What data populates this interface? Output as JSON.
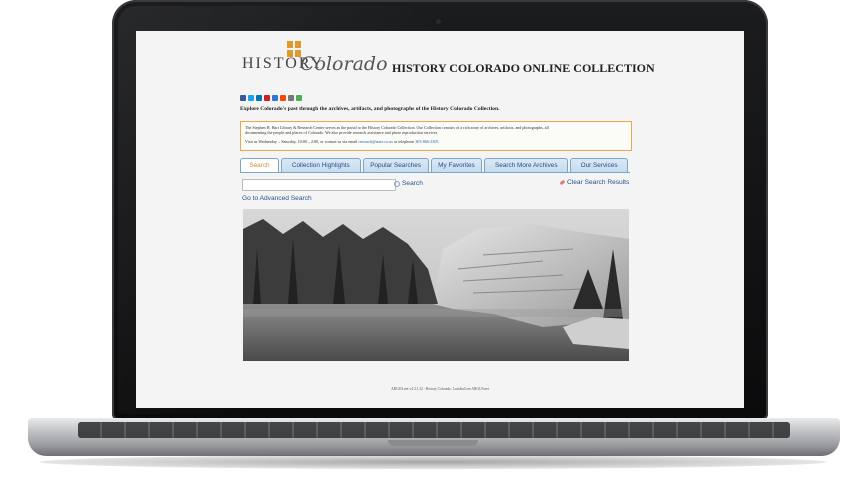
{
  "site": {
    "logo_word": "HISTORY",
    "logo_script": "Colorado",
    "title": "HISTORY COLORADO ONLINE COLLECTION",
    "tagline": "Explore Colorado's past through the archives, artifacts, and photographs of the History Colorado Collection."
  },
  "social_icons": [
    {
      "name": "facebook-icon",
      "color": "#3b5998"
    },
    {
      "name": "twitter-icon",
      "color": "#1da1f2"
    },
    {
      "name": "linkedin-icon",
      "color": "#0077b5"
    },
    {
      "name": "pinterest-icon",
      "color": "#cb2027"
    },
    {
      "name": "delicious-icon",
      "color": "#3274d1"
    },
    {
      "name": "reddit-icon",
      "color": "#ff4500"
    },
    {
      "name": "email-icon",
      "color": "#777777"
    },
    {
      "name": "share-icon",
      "color": "#4caf50"
    }
  ],
  "info": {
    "line1": "The Stephen H. Hart Library & Research Center serves as the portal to the History Colorado Collection. Our Collection consists of a rich array of archives, artifacts, and photographs, all",
    "line2": "documenting the people and places of Colorado. We also provide research assistance and photo reproduction services.",
    "line3_prefix": "Visit us Wednesday – Saturday, 10:00 – 2:00, or contact us via email",
    "email": "research@state.co.us",
    "line3_mid": "or telephone",
    "phone": "303-866-2305."
  },
  "tabs": [
    {
      "label": "Search",
      "active": true
    },
    {
      "label": "Collection Highlights",
      "active": false
    },
    {
      "label": "Popular Searches",
      "active": false
    },
    {
      "label": "My Favorites",
      "active": false
    },
    {
      "label": "Search More Archives",
      "active": false
    },
    {
      "label": "Our Services",
      "active": false
    }
  ],
  "search": {
    "placeholder": "",
    "button_label": "Search",
    "clear_label": "Clear Search Results",
    "advanced_label": "Go to Advanced Search"
  },
  "footer": "ARGUS.net v4.3.1.32 - History Colorado. LucidiaCore ARGUS.net",
  "colors": {
    "accent_orange": "#d88c2a",
    "link_blue": "#27508a",
    "tab_border": "#7aa6c8"
  }
}
